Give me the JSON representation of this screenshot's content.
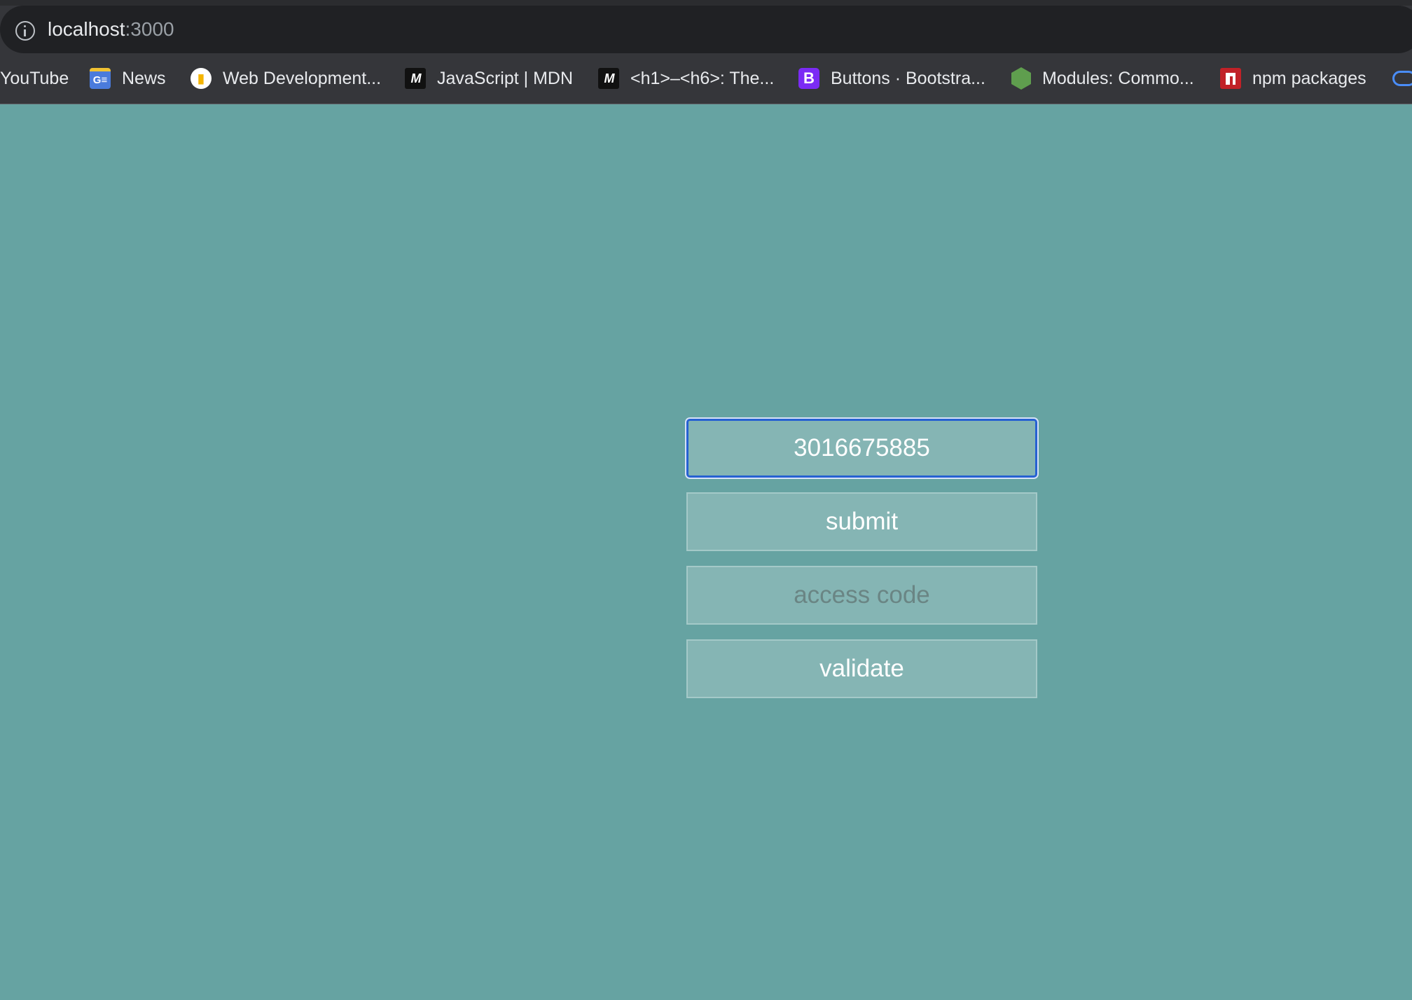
{
  "browser": {
    "url_host": "localhost",
    "url_port": ":3000",
    "bookmarks": [
      {
        "label": "YouTube",
        "icon": "none"
      },
      {
        "label": "News",
        "icon": "google-news-icon"
      },
      {
        "label": "Web Development...",
        "icon": "web-dev-icon"
      },
      {
        "label": "JavaScript | MDN",
        "icon": "mdn-icon"
      },
      {
        "label": "<h1>–<h6>: The...",
        "icon": "mdn-icon"
      },
      {
        "label": "Buttons · Bootstra...",
        "icon": "bootstrap-icon"
      },
      {
        "label": "Modules: Commo...",
        "icon": "nodejs-icon"
      },
      {
        "label": "npm packages",
        "icon": "npm-icon"
      }
    ]
  },
  "form": {
    "phone_value": "3016675885",
    "submit_label": "submit",
    "access_code_placeholder": "access code",
    "validate_label": "validate"
  },
  "colors": {
    "page_background": "#66a3a2",
    "field_background": "#85b5b4",
    "focus_ring": "#2661d2"
  }
}
